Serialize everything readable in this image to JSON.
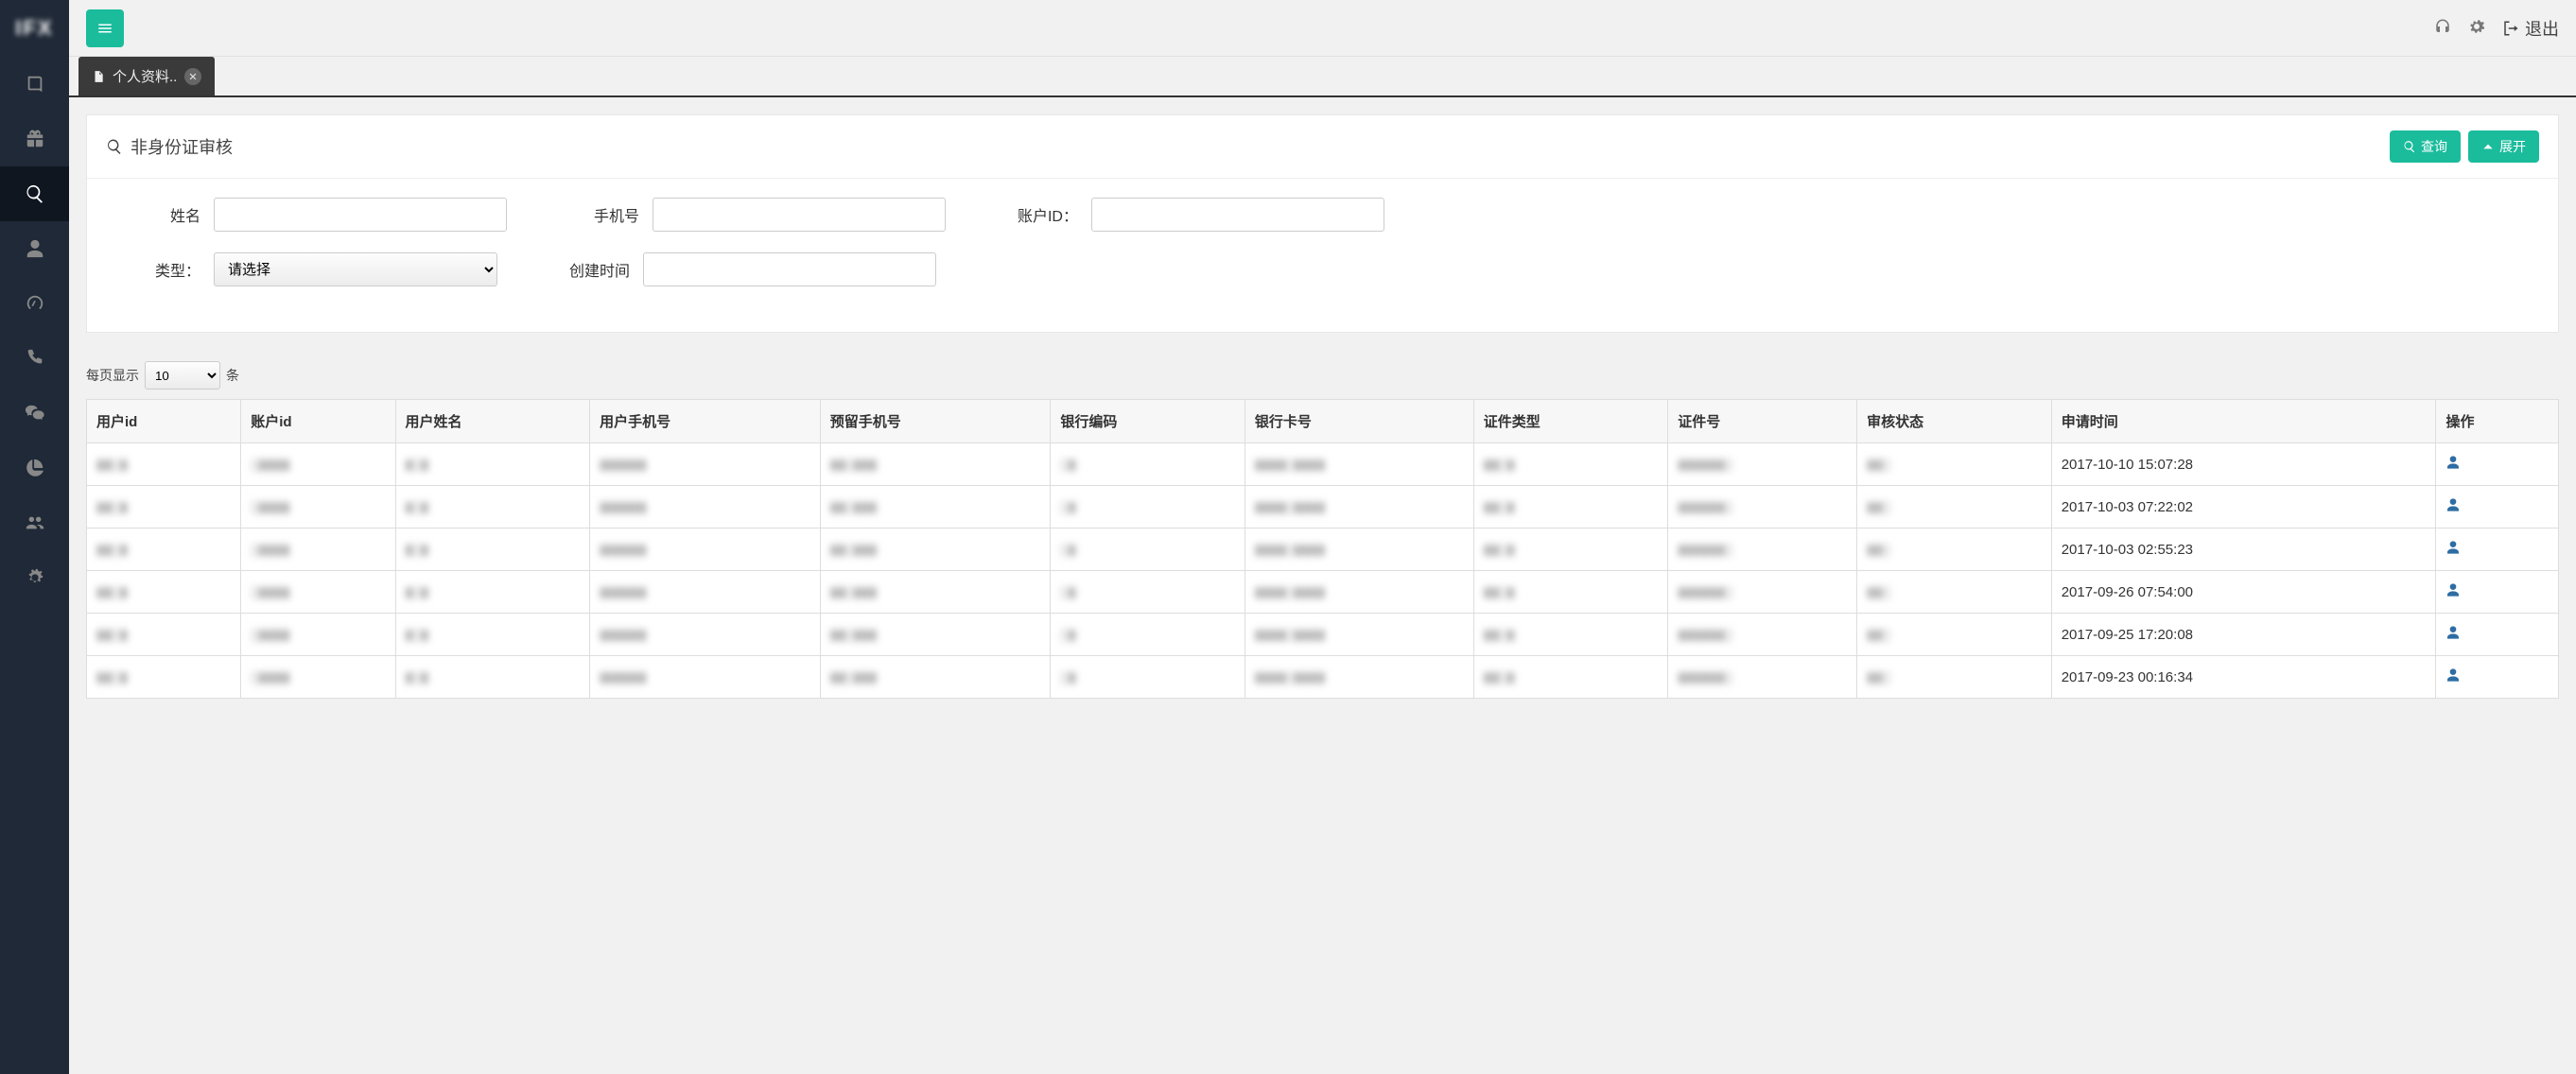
{
  "sidebar": {
    "logo": "IFX"
  },
  "topbar": {
    "logout_label": "退出"
  },
  "tab": {
    "label": "个人资料.."
  },
  "panel": {
    "title": "非身份证审核",
    "query_btn": "查询",
    "expand_btn": "展开"
  },
  "form": {
    "name_label": "姓名",
    "phone_label": "手机号",
    "account_label": "账户ID：",
    "type_label": "类型：",
    "type_placeholder": "请选择",
    "create_time_label": "创建时间"
  },
  "paging": {
    "prefix": "每页显示",
    "value": "10",
    "suffix": "条"
  },
  "table": {
    "headers": [
      "用户id",
      "账户id",
      "用户姓名",
      "用户手机号",
      "预留手机号",
      "银行编码",
      "银行卡号",
      "证件类型",
      "证件号",
      "审核状态",
      "申请时间",
      "操作"
    ],
    "rows": [
      {
        "time": "2017-10-10 15:07:28"
      },
      {
        "time": "2017-10-03 07:22:02"
      },
      {
        "time": "2017-10-03 02:55:23"
      },
      {
        "time": "2017-09-26 07:54:00"
      },
      {
        "time": "2017-09-25 17:20:08"
      },
      {
        "time": "2017-09-23 00:16:34"
      }
    ]
  }
}
